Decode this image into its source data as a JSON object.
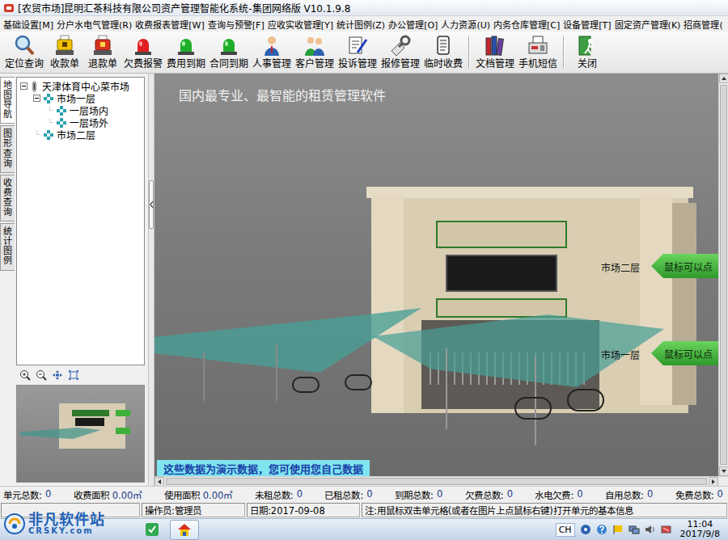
{
  "window": {
    "title": "[农贸市场]昆明汇茶科技有限公司资产管理智能化系统-集团网络版 V10.1.9.8"
  },
  "menu": [
    "基础设置[M]",
    "分户水电气管理(R)",
    "收费报表管理[W]",
    "查询与预警[F]",
    "应收实收管理[Y]",
    "统计图例(Z)",
    "办公管理[O]",
    "人力资源(U)",
    "内务仓库管理[C]",
    "设备管理[T]",
    "固定资产管理(K)",
    "招商管理("
  ],
  "toolbar": {
    "groups": [
      [
        "定位查询",
        "收款单",
        "退款单",
        "欠费报警",
        "费用到期",
        "合同到期",
        "人事管理",
        "客户管理",
        "投诉管理",
        "报修管理",
        "临时收费"
      ],
      [
        "文档管理",
        "手机短信"
      ],
      [
        "关闭"
      ]
    ]
  },
  "side_tabs": [
    {
      "label": "地图导航",
      "selected": true
    },
    {
      "label": "图形查询",
      "selected": false
    },
    {
      "label": "收费查询",
      "selected": false
    },
    {
      "label": "统计图例",
      "selected": false
    }
  ],
  "tree": [
    {
      "label": "天津体育中心菜市场",
      "depth": 0,
      "kind": "root",
      "expanded": true
    },
    {
      "label": "市场一层",
      "depth": 1,
      "kind": "branch",
      "expanded": true
    },
    {
      "label": "一层场内",
      "depth": 2,
      "kind": "leaf",
      "expanded": false
    },
    {
      "label": "一层场外",
      "depth": 2,
      "kind": "leaf",
      "expanded": false
    },
    {
      "label": "市场二层",
      "depth": 1,
      "kind": "leaf",
      "expanded": false
    }
  ],
  "scene": {
    "slogan": "国内最专业、最智能的租赁管理软件",
    "floors": [
      {
        "label": "市场二层",
        "hint": "鼠标可以点"
      },
      {
        "label": "市场一层",
        "hint": "鼠标可以点"
      }
    ],
    "banner": "这些数据为演示数据，您可使用您自己数据"
  },
  "stats": [
    {
      "label": "单元总数:",
      "value": "0"
    },
    {
      "label": "收费面积",
      "value": "0.00㎡"
    },
    {
      "label": "使用面积",
      "value": "0.00㎡"
    },
    {
      "label": "未租总数:",
      "value": "0"
    },
    {
      "label": "已租总数:",
      "value": "0"
    },
    {
      "label": "到期总数:",
      "value": "0"
    },
    {
      "label": "欠费总数:",
      "value": "0"
    },
    {
      "label": "水电欠费:",
      "value": "0"
    },
    {
      "label": "自用总数:",
      "value": "0"
    },
    {
      "label": "免费总数:",
      "value": "0"
    }
  ],
  "status": [
    "操作员:管理员",
    "日期:2017-09-08",
    "注:用鼠标双击单元格(或者在图片上点鼠标右键)打开单元的基本信息"
  ],
  "taskbar": {
    "lang": "CH",
    "time": "11:04",
    "date": "2017/9/8"
  },
  "watermark": {
    "name": "非凡软件站",
    "site": "CRSKY.com"
  }
}
